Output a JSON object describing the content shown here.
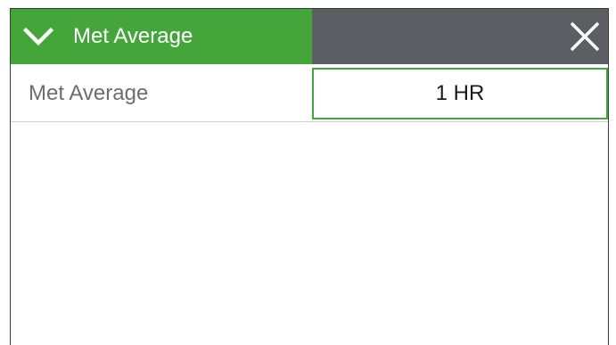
{
  "header": {
    "title": "Met Average",
    "expand_icon": "chevron-down-icon",
    "close_icon": "close-icon"
  },
  "setting": {
    "label": "Met Average",
    "value": "1 HR"
  },
  "colors": {
    "header_green": "#44a63a",
    "header_gray": "#5b5e63",
    "value_border": "#44a63a",
    "label_text": "#6d6d6d"
  }
}
